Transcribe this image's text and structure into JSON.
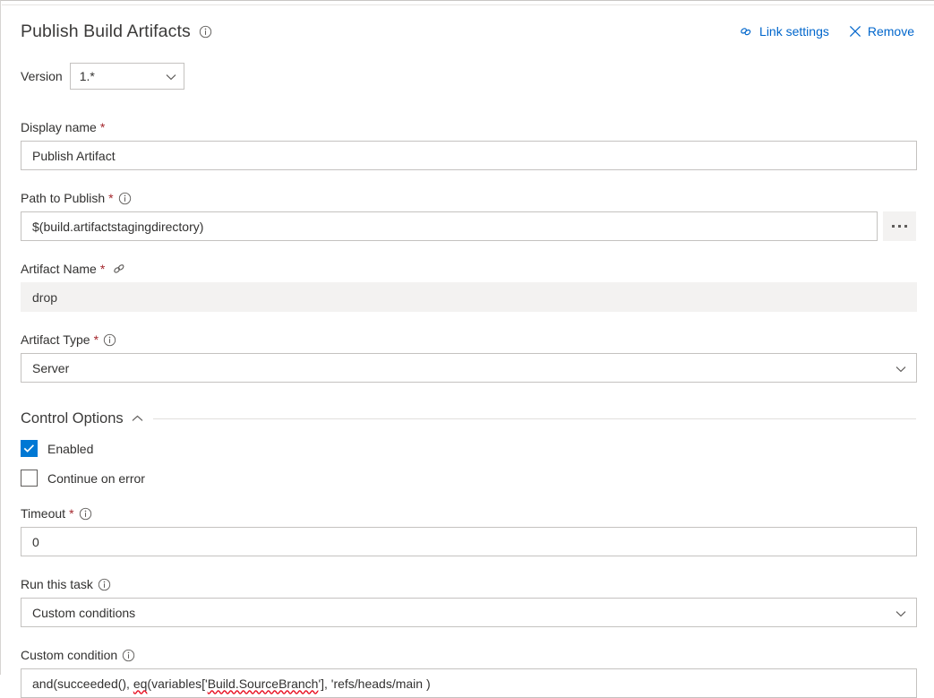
{
  "theme": {
    "accent": "#0078d4",
    "link": "#0066cc",
    "required_asterisk": "#a4262c",
    "text": "#323130",
    "border": "#c4c2c0",
    "readonly_bg": "#f3f2f1",
    "spellcheck_underline": "#e81123"
  },
  "header": {
    "title": "Publish Build Artifacts",
    "info_icon": "info-icon",
    "actions": [
      {
        "label": "Link settings",
        "icon": "link-icon"
      },
      {
        "label": "Remove",
        "icon": "close-icon"
      }
    ]
  },
  "version": {
    "label": "Version",
    "value": "1.*",
    "chevron_icon": "chevron-down-icon"
  },
  "fields": {
    "display_name": {
      "label": "Display name",
      "required": true,
      "has_info": false,
      "value": "Publish Artifact"
    },
    "path_to_publish": {
      "label": "Path to Publish",
      "required": true,
      "has_info": true,
      "info_icon": "info-icon",
      "value": "$(build.artifactstagingdirectory)",
      "browse_button": "ellipsis-button"
    },
    "artifact_name": {
      "label": "Artifact Name",
      "required": true,
      "linked": true,
      "link_icon": "link-icon",
      "value": "drop",
      "readonly": true
    },
    "artifact_type": {
      "label": "Artifact Type",
      "required": true,
      "has_info": true,
      "info_icon": "info-icon",
      "value": "Server",
      "chevron_icon": "chevron-down-icon"
    },
    "timeout": {
      "label": "Timeout",
      "required": true,
      "has_info": true,
      "info_icon": "info-icon",
      "value": "0"
    },
    "run_this_task": {
      "label": "Run this task",
      "required": false,
      "has_info": true,
      "info_icon": "info-icon",
      "value": "Custom conditions",
      "chevron_icon": "chevron-down-icon"
    },
    "custom_condition": {
      "label": "Custom condition",
      "required": false,
      "has_info": true,
      "info_icon": "info-icon",
      "value": "and(succeeded(), eq(variables['Build.SourceBranch'], 'refs/heads/main )",
      "segments": [
        {
          "text": "and(succeeded(), ",
          "misspelled": false
        },
        {
          "text": "eq",
          "misspelled": true
        },
        {
          "text": "(variables['",
          "misspelled": false
        },
        {
          "text": "Build.SourceBranch",
          "misspelled": true
        },
        {
          "text": "'], 'refs/heads/main )",
          "misspelled": false
        }
      ]
    }
  },
  "control_options": {
    "title": "Control Options",
    "collapse_icon": "chevron-up-icon",
    "expanded": true,
    "checkboxes": [
      {
        "label": "Enabled",
        "checked": true
      },
      {
        "label": "Continue on error",
        "checked": false
      }
    ]
  }
}
